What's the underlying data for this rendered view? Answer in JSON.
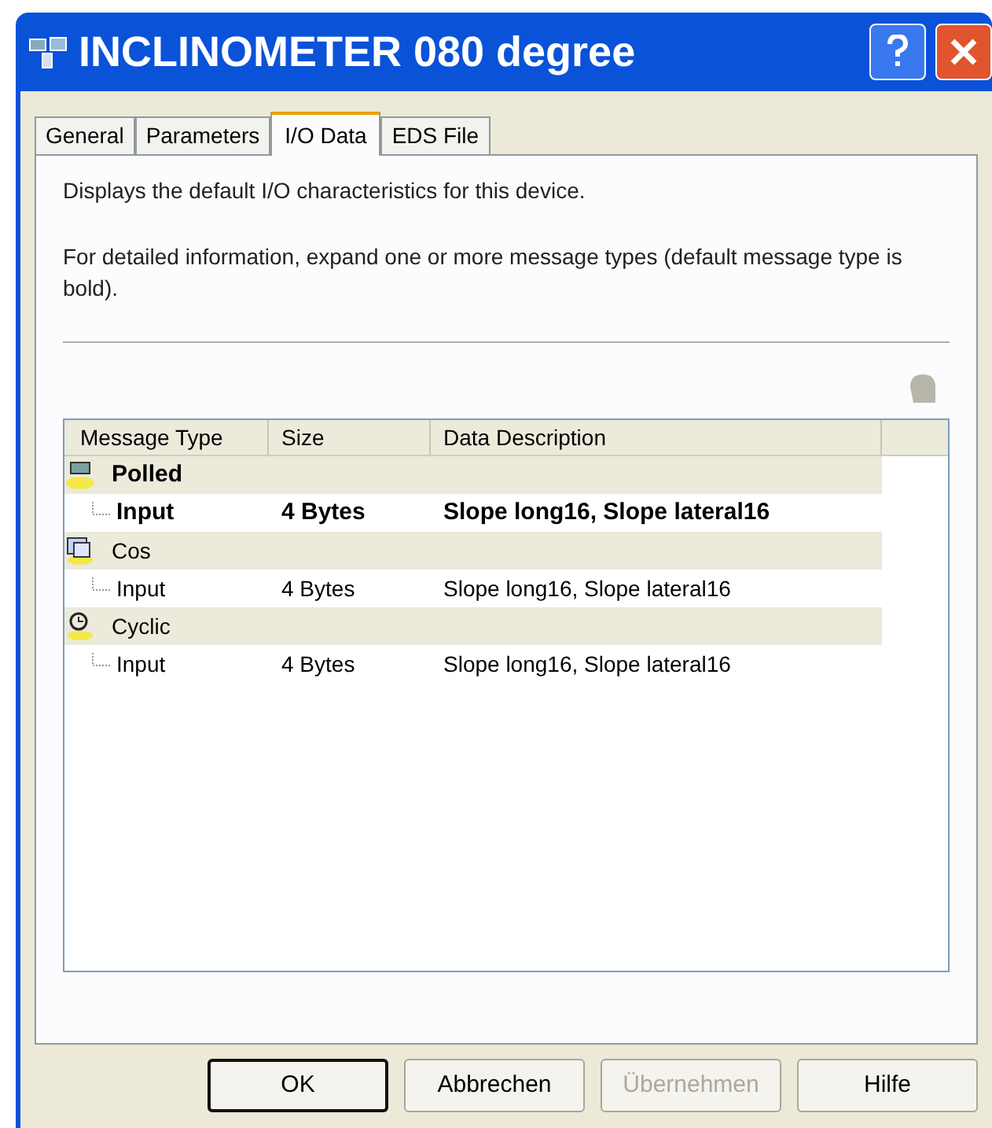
{
  "window": {
    "title": "INCLINOMETER 080 degree"
  },
  "tabs": [
    {
      "label": "General",
      "selected": false
    },
    {
      "label": "Parameters",
      "selected": false
    },
    {
      "label": "I/O Data",
      "selected": true
    },
    {
      "label": "EDS File",
      "selected": false
    }
  ],
  "intro": "Displays the default I/O characteristics for this device.",
  "detail": "For detailed information, expand one or more message types (default message type is bold).",
  "table": {
    "columns": [
      "Message Type",
      "Size",
      "Data Description"
    ],
    "groups": [
      {
        "kind": "polled",
        "name": "Polled",
        "default": true,
        "children": [
          {
            "name": "Input",
            "size": "4 Bytes",
            "description": "Slope long16, Slope lateral16"
          }
        ]
      },
      {
        "kind": "cos",
        "name": "Cos",
        "default": false,
        "children": [
          {
            "name": "Input",
            "size": "4 Bytes",
            "description": "Slope long16, Slope lateral16"
          }
        ]
      },
      {
        "kind": "cyclic",
        "name": "Cyclic",
        "default": false,
        "children": [
          {
            "name": "Input",
            "size": "4 Bytes",
            "description": "Slope long16, Slope lateral16"
          }
        ]
      }
    ]
  },
  "buttons": [
    {
      "label": "OK",
      "disabled": false,
      "default": true
    },
    {
      "label": "Abbrechen",
      "disabled": false,
      "default": false
    },
    {
      "label": "Übernehmen",
      "disabled": true,
      "default": false
    },
    {
      "label": "Hilfe",
      "disabled": false,
      "default": false
    }
  ]
}
